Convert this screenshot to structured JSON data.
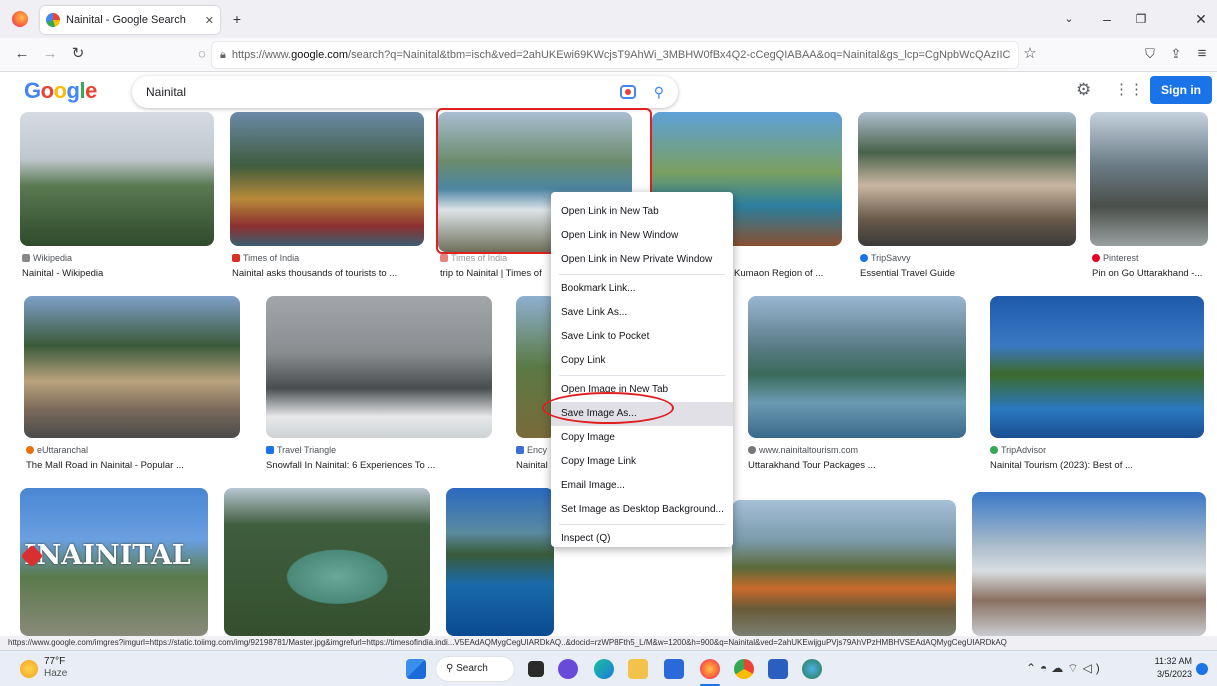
{
  "browser": {
    "tab_title": "Nainital - Google Search",
    "url_prefix": "https://www.",
    "url_domain": "google.com",
    "url_rest": "/search?q=Nainital&tbm=isch&ved=2ahUKEwi69KWcjsT9AhWi_3MBHW0fBx4Q2-cCegQIABAA&oq=Nainital&gs_lcp=CgNpbWcQAzIIC"
  },
  "google": {
    "logo": "Google",
    "query": "Nainital",
    "sign_in": "Sign in"
  },
  "results": [
    {
      "source": "Wikipedia",
      "caption": "Nainital - Wikipedia"
    },
    {
      "source": "Times of India",
      "caption": "Nainital asks thousands of tourists to ..."
    },
    {
      "source": "Times of India",
      "caption": "trip to Nainital | Times of"
    },
    {
      "source": "",
      "caption": "Kumaon Region of ..."
    },
    {
      "source": "TripSavvy",
      "caption": "Essential Travel Guide"
    },
    {
      "source": "Pinterest",
      "caption": "Pin on Go Uttarakhand -..."
    },
    {
      "source": "eUttaranchal",
      "caption": "The Mall Road in Nainital - Popular ..."
    },
    {
      "source": "Travel Triangle",
      "caption": "Snowfall In Nainital: 6 Experiences To ..."
    },
    {
      "source": "Ency",
      "caption": "Nainital"
    },
    {
      "source": "www.nainitaltourism.com",
      "caption": "Uttarakhand Tour Packages ..."
    },
    {
      "source": "TripAdvisor",
      "caption": "Nainital Tourism (2023): Best of ..."
    },
    {
      "source": "",
      "caption": ""
    }
  ],
  "banner_text": "INAINITAL",
  "context_menu": [
    "Open Link in New Tab",
    "Open Link in New Window",
    "Open Link in New Private Window",
    "Bookmark Link...",
    "Save Link As...",
    "Save Link to Pocket",
    "Copy Link",
    "Open Image in New Tab",
    "Save Image As...",
    "Copy Image",
    "Copy Image Link",
    "Email Image...",
    "Set Image as Desktop Background...",
    "Inspect (Q)"
  ],
  "status_url": "https://www.google.com/imgres?imgurl=https://static.toiimg.com/img/92198781/Master.jpg&imgrefurl=https://timesofindia.indi...V5EAdAQMygCegUIARDkAQ..&docid=rzWP8Fth5_L/M&w=1200&h=900&q=Nainital&ved=2ahUKEwijguPVjs79AhVPzHMBHVSEAdAQMygCegUIARDkAQ",
  "taskbar": {
    "weather_temp": "77°F",
    "weather_desc": "Haze",
    "search_label": "Search",
    "time": "11:32 AM",
    "date": "3/5/2023"
  },
  "colors": {
    "accent": "#1a73e8",
    "annotation": "#e02020"
  }
}
